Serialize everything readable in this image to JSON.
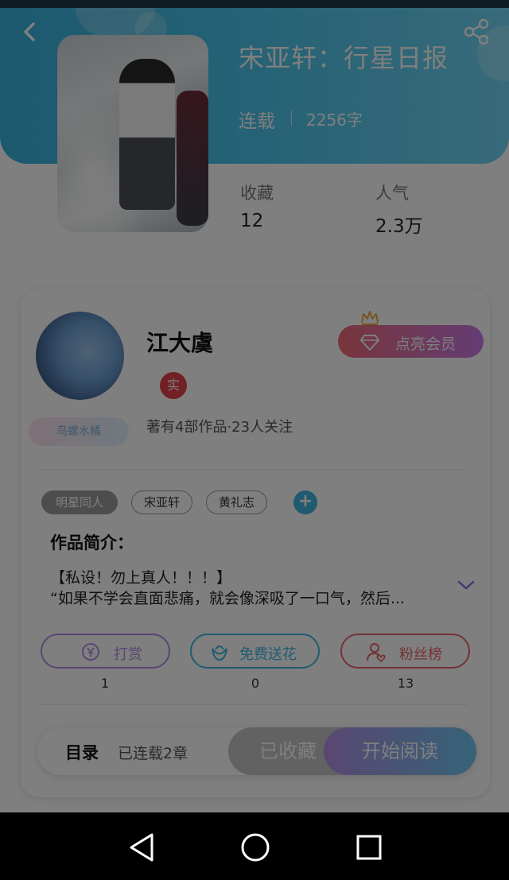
{
  "book": {
    "title": "宋亚轩：行星日报",
    "status": "连载",
    "word_count": "2256字"
  },
  "stats": {
    "favorites_label": "收藏",
    "favorites_value": "12",
    "popularity_label": "人气",
    "popularity_value": "2.3万"
  },
  "author": {
    "name": "江大虞",
    "real_badge": "实",
    "stats": "著有4部作品·23人关注",
    "badge_tag": "鸟螺水橘",
    "vip_button": "点亮会员"
  },
  "tags": [
    "明星同人",
    "宋亚轩",
    "黄礼志"
  ],
  "intro": {
    "title": "作品简介：",
    "line1": "【私设！勿上真人！！！】",
    "line2": "“如果不学会直面悲痛，就会像深吸了一口气，然后..."
  },
  "actions": [
    {
      "label": "打赏",
      "count": "1",
      "color": "#b38ae6",
      "icon": "yuan-coin-icon"
    },
    {
      "label": "免费送花",
      "count": "0",
      "color": "#3fb7e2",
      "icon": "flower-icon"
    },
    {
      "label": "粉丝榜",
      "count": "13",
      "color": "#e8636c",
      "icon": "fan-heart-icon"
    }
  ],
  "bottom": {
    "toc": "目录",
    "chapters": "已连载2章",
    "favorited": "已收藏",
    "start_reading": "开始阅读"
  },
  "colors": {
    "header": "#49c3ea",
    "accent_red": "#e2404c",
    "accent_blue": "#3eb4df"
  }
}
